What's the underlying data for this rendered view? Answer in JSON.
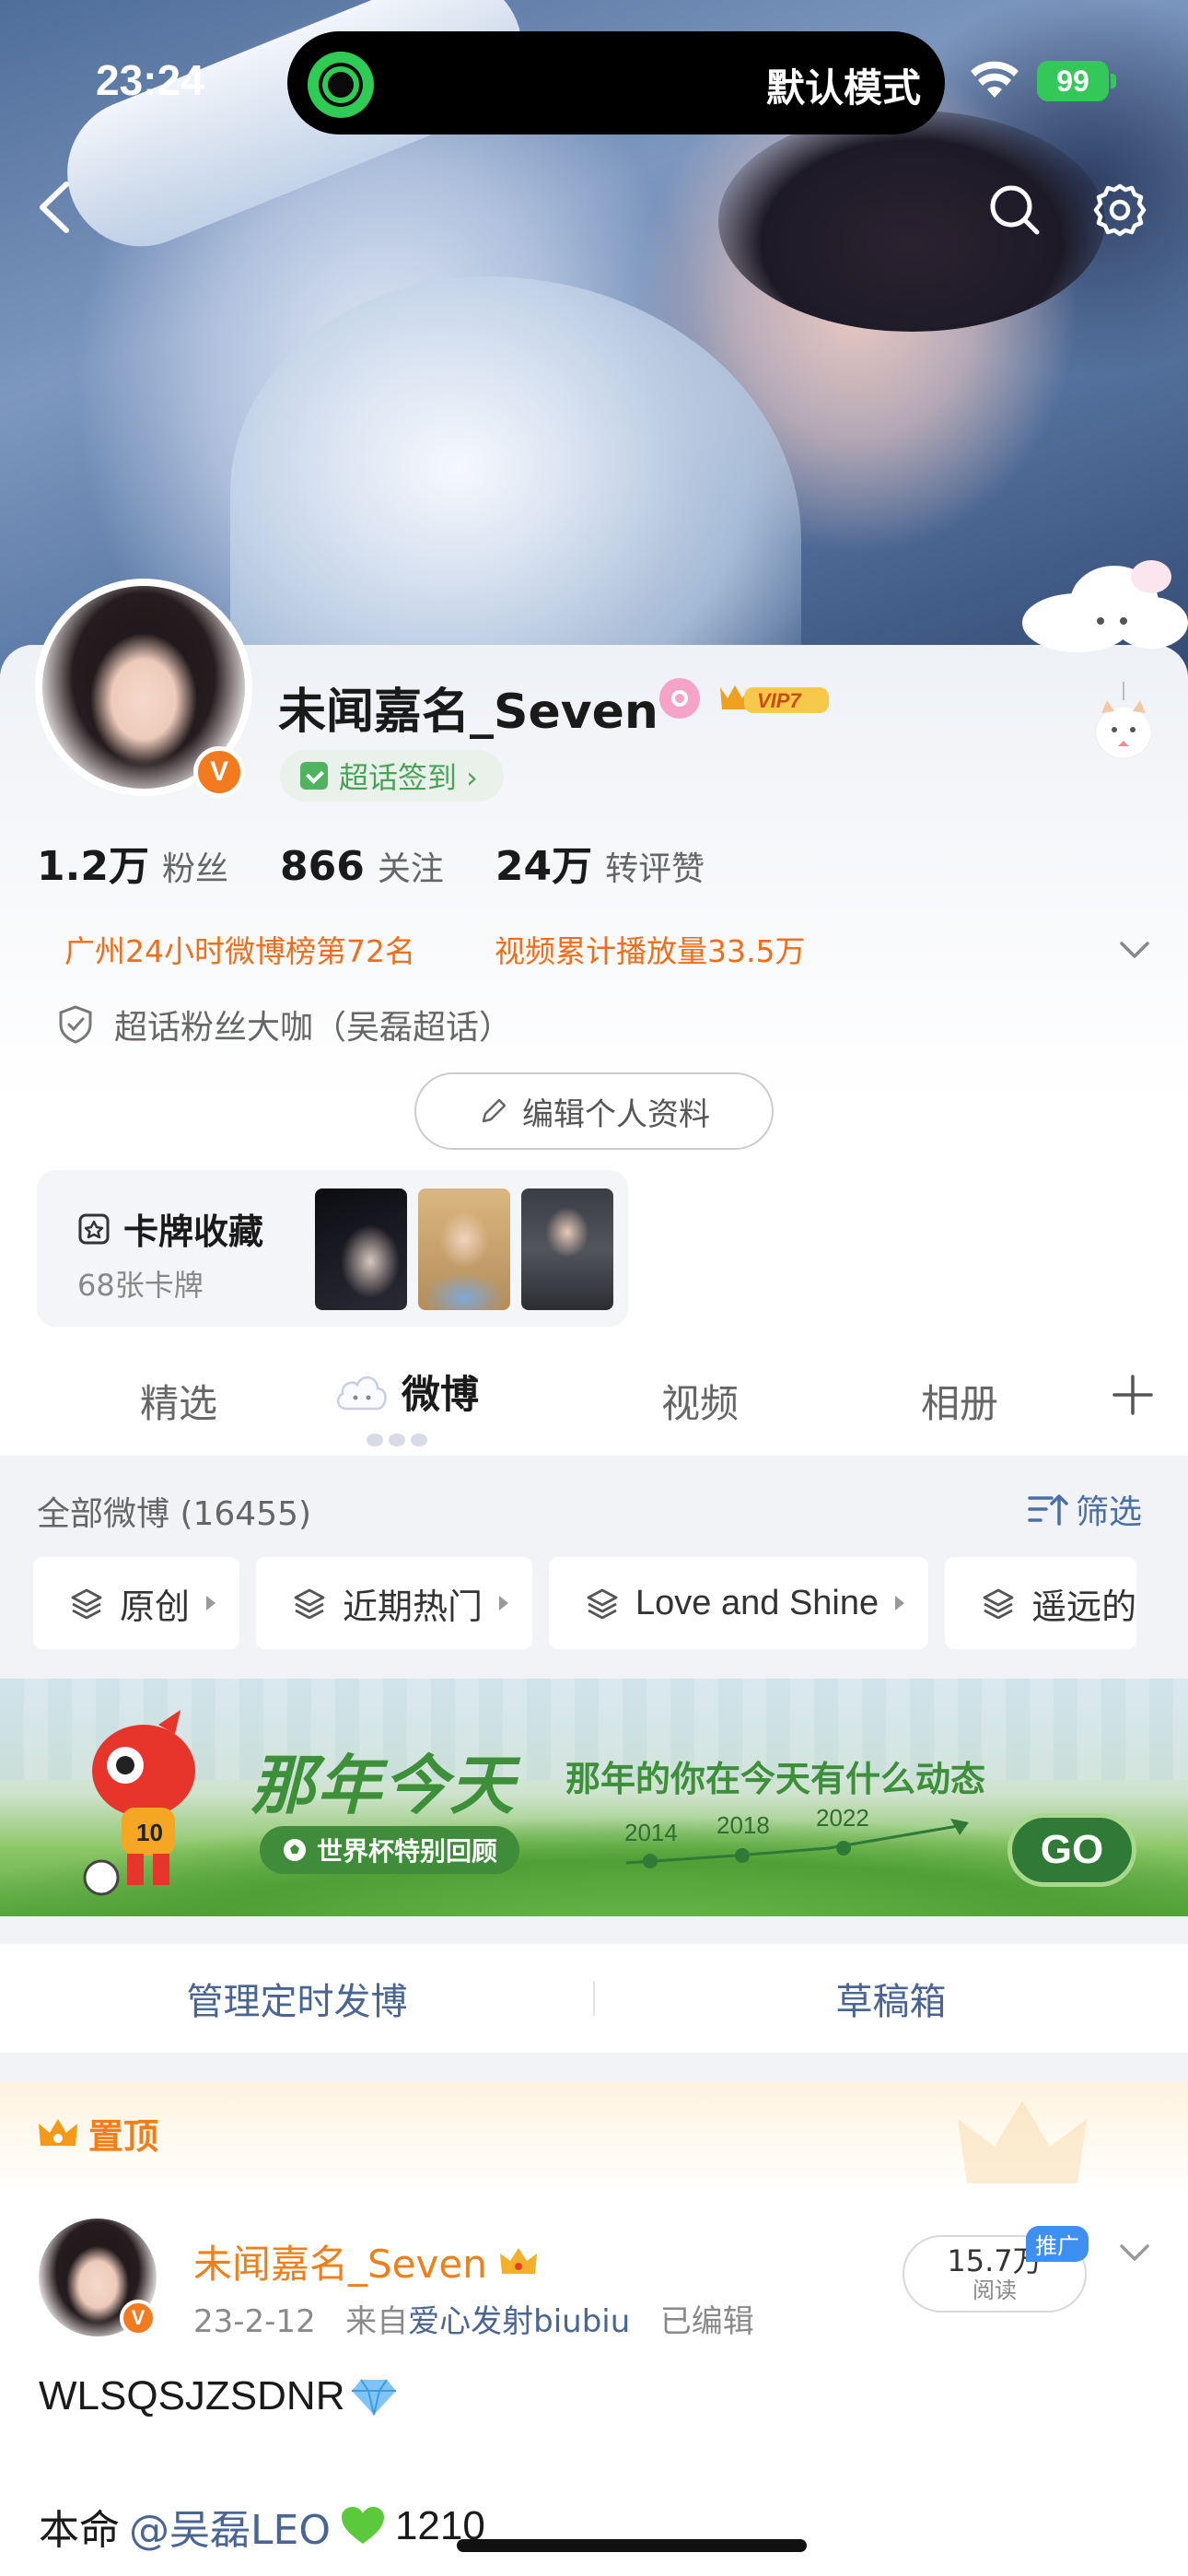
{
  "status_bar": {
    "time": "23:24",
    "island_mode": "默认模式",
    "battery": "99",
    "icons": [
      "wifi-icon",
      "battery-icon"
    ]
  },
  "nav": {
    "icons": [
      "back-icon",
      "search-icon",
      "settings-icon"
    ]
  },
  "profile": {
    "name": "未闻嘉名_Seven",
    "badges": [
      "v-verified",
      "super-topic-badge"
    ],
    "vip_label": "VIP7",
    "checkin_label": "超话签到 ›",
    "stats": [
      {
        "value": "1.2万",
        "label": "粉丝"
      },
      {
        "value": "866",
        "label": "关注"
      },
      {
        "value": "24万",
        "label": "转评赞"
      }
    ],
    "tags": [
      "广州24小时微博榜第72名",
      "视频累计播放量33.5万"
    ],
    "title": "超话粉丝大咖（吴磊超话）",
    "edit_button": "编辑个人资料"
  },
  "card_collection": {
    "title": "卡牌收藏",
    "subtitle": "68张卡牌",
    "thumb_count": 3
  },
  "tabs": {
    "items": [
      "精选",
      "微博",
      "视频",
      "相册"
    ],
    "active": "微博"
  },
  "feed": {
    "header": "全部微博 (16455)",
    "filter_label": "筛选",
    "chips": [
      "原创",
      "近期热门",
      "Love and Shine",
      "遥远的"
    ]
  },
  "banner": {
    "title": "那年今天",
    "subtitle": "那年的你在今天有什么动态",
    "pill": "世界杯特别回顾",
    "years": [
      "2014",
      "2018",
      "2022"
    ],
    "button": "GO",
    "mascot_jersey": "10"
  },
  "manage": {
    "left": "管理定时发博",
    "right": "草稿箱"
  },
  "pinned_post": {
    "pinned_label": "置顶",
    "author": "未闻嘉名_Seven",
    "date": "23-2-12",
    "source_prefix": "来自",
    "source": "爱心发射biubiu",
    "edited": "已编辑",
    "read_count": "15.7万",
    "read_label": "阅读",
    "promo_label": "推广",
    "line1": "WLSQSJZSDNR",
    "line2_prefix": "本命",
    "mention": "@吴磊LEO",
    "line2_suffix": "1210"
  },
  "colors": {
    "accent_orange": "#f07f1a",
    "link_blue": "#4a6594",
    "checkin_green": "#4aa35a",
    "vip_gold": "#e8a21c",
    "banner_green": "#3d8f3a"
  }
}
